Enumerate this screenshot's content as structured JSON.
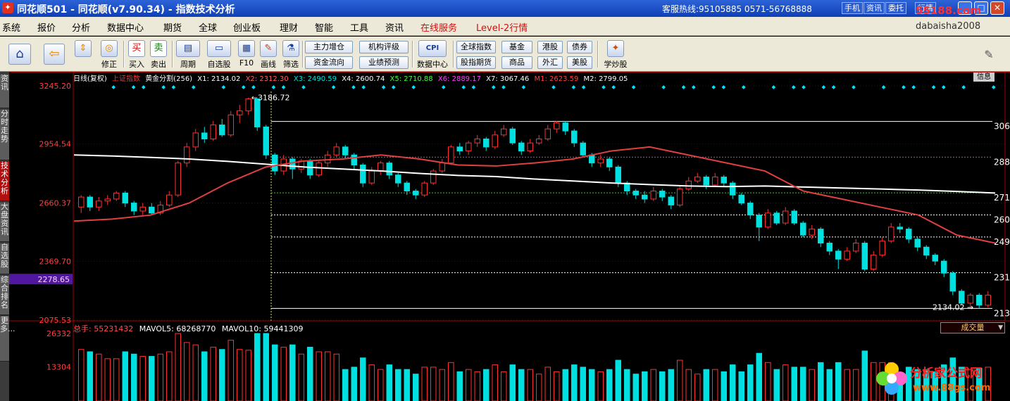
{
  "window": {
    "title": "同花顺501 - 同花顺(v7.90.34) - 指数技术分析",
    "hotline": "客服热线:95105885  0571-56768888",
    "buttons": [
      "手机",
      "资讯",
      "委托",
      "行情"
    ],
    "watermark_top": "55188.com"
  },
  "menu": {
    "items": [
      "系统",
      "报价",
      "分析",
      "数据中心",
      "期货",
      "全球",
      "创业板",
      "理财",
      "智能",
      "工具",
      "资讯"
    ],
    "highlight_items": [
      "在线服务",
      "Level-2行情"
    ],
    "user": "dabaisha2008"
  },
  "toolbar": {
    "big": [
      {
        "icon": "home-icon",
        "glyph": "⌂",
        "label": ""
      },
      {
        "icon": "back-arrow-icon",
        "glyph": "⇦",
        "label": ""
      },
      {
        "icon": "up-down-icon",
        "glyph": "⇕",
        "label": ""
      },
      {
        "icon": "refresh-icon",
        "glyph": "◎",
        "label": "修正"
      },
      {
        "icon": "buy-icon",
        "glyph": "买",
        "label": "买入"
      },
      {
        "icon": "sell-icon",
        "glyph": "卖",
        "label": "卖出"
      },
      {
        "icon": "period-icon",
        "glyph": "▤",
        "label": "周期"
      },
      {
        "icon": "watchlist-icon",
        "glyph": "▭",
        "label": "自选股"
      },
      {
        "icon": "f10-icon",
        "glyph": "▦",
        "label": "F10"
      },
      {
        "icon": "draw-line-icon",
        "glyph": "✎",
        "label": "画线"
      },
      {
        "icon": "filter-icon",
        "glyph": "⚗",
        "label": "筛选"
      }
    ],
    "small_grid": [
      [
        "主力增仓",
        "资金流向"
      ],
      [
        "机构评级",
        "业绩预测"
      ]
    ],
    "data_center": {
      "glyph": "CPI",
      "label": "数据中心"
    },
    "market_buttons": [
      [
        "全球指数",
        "股指期货"
      ],
      [
        "基金",
        "商品"
      ],
      [
        "港股",
        "外汇"
      ],
      [
        "债券",
        "美股"
      ]
    ],
    "learn": {
      "glyph": "✦",
      "label": "学炒股"
    },
    "settings_icon": "wrench-icon"
  },
  "left_tabs": [
    "资讯",
    "分时走势",
    "技术分析",
    "大盘资讯",
    "自选股",
    "综合排名",
    "更多..."
  ],
  "left_tabs_active": 2,
  "chart_info": {
    "period": "日线(复权)",
    "name": "上证指数",
    "golden": "黄金分割(256)",
    "levels": [
      {
        "label": "X1: 2134.02",
        "color": "#ffffff"
      },
      {
        "label": "X2: 2312.30",
        "color": "#ff6060"
      },
      {
        "label": "X3: 2490.59",
        "color": "#00e0e0"
      },
      {
        "label": "X4: 2600.74",
        "color": "#ffffff"
      },
      {
        "label": "X5: 2710.88",
        "color": "#40ff40"
      },
      {
        "label": "X6: 2889.17",
        "color": "#ff40ff"
      },
      {
        "label": "X7: 3067.46",
        "color": "#ffffff"
      },
      {
        "label": "M1: 2623.59",
        "color": "#ff4040"
      },
      {
        "label": "M2: 2799.05",
        "color": "#ffffff"
      }
    ],
    "info_button": "信息"
  },
  "chart_data": {
    "type": "candlestick",
    "y_ticks": [
      "3245.20",
      "2954.54",
      "2660.37",
      "2369.70",
      "2075.53"
    ],
    "y_tick_values": [
      3245.2,
      2954.54,
      2660.37,
      2369.7,
      2075.53
    ],
    "current_price": "2278.65",
    "ylim": [
      2075.53,
      3245.2
    ],
    "right_labels": [
      "306",
      "288",
      "271",
      "260",
      "249",
      "231",
      "213"
    ],
    "golden_levels": [
      3067.46,
      2889.17,
      2710.88,
      2600.74,
      2490.59,
      2312.3,
      2134.02
    ],
    "high_label": "3186.72",
    "low_label": "2134.02",
    "candles": [
      [
        2640,
        2690,
        2610,
        2700
      ],
      [
        2690,
        2640,
        2620,
        2700
      ],
      [
        2640,
        2670,
        2620,
        2690
      ],
      [
        2670,
        2680,
        2650,
        2700
      ],
      [
        2680,
        2710,
        2670,
        2720
      ],
      [
        2710,
        2660,
        2640,
        2720
      ],
      [
        2660,
        2620,
        2600,
        2670
      ],
      [
        2620,
        2640,
        2600,
        2660
      ],
      [
        2640,
        2610,
        2600,
        2660
      ],
      [
        2610,
        2650,
        2600,
        2670
      ],
      [
        2650,
        2700,
        2640,
        2720
      ],
      [
        2700,
        2860,
        2690,
        2870
      ],
      [
        2860,
        2940,
        2840,
        2960
      ],
      [
        2940,
        3010,
        2920,
        3030
      ],
      [
        3010,
        2980,
        2960,
        3040
      ],
      [
        2980,
        3050,
        2970,
        3070
      ],
      [
        3050,
        3000,
        2990,
        3080
      ],
      [
        3000,
        3100,
        2990,
        3120
      ],
      [
        3100,
        3120,
        3060,
        3150
      ],
      [
        3120,
        3180,
        3100,
        3186.72
      ],
      [
        3180,
        3040,
        3020,
        3180
      ],
      [
        3040,
        2900,
        2880,
        3050
      ],
      [
        2900,
        2820,
        2800,
        2910
      ],
      [
        2820,
        2880,
        2800,
        2900
      ],
      [
        2880,
        2830,
        2780,
        2890
      ],
      [
        2830,
        2870,
        2810,
        2880
      ],
      [
        2870,
        2800,
        2780,
        2880
      ],
      [
        2800,
        2860,
        2790,
        2870
      ],
      [
        2860,
        2900,
        2840,
        2920
      ],
      [
        2900,
        2940,
        2890,
        2960
      ],
      [
        2940,
        2900,
        2880,
        2950
      ],
      [
        2900,
        2850,
        2830,
        2910
      ],
      [
        2850,
        2760,
        2740,
        2860
      ],
      [
        2760,
        2820,
        2750,
        2840
      ],
      [
        2820,
        2860,
        2800,
        2870
      ],
      [
        2860,
        2800,
        2780,
        2870
      ],
      [
        2800,
        2760,
        2740,
        2810
      ],
      [
        2760,
        2720,
        2700,
        2770
      ],
      [
        2720,
        2700,
        2680,
        2730
      ],
      [
        2700,
        2760,
        2690,
        2770
      ],
      [
        2760,
        2820,
        2750,
        2830
      ],
      [
        2820,
        2860,
        2810,
        2880
      ],
      [
        2860,
        2940,
        2850,
        2950
      ],
      [
        2940,
        2920,
        2900,
        2960
      ],
      [
        2920,
        2960,
        2900,
        2970
      ],
      [
        2960,
        2980,
        2940,
        3000
      ],
      [
        2980,
        2940,
        2920,
        2990
      ],
      [
        2940,
        3000,
        2930,
        3020
      ],
      [
        3000,
        3030,
        2990,
        3050
      ],
      [
        3030,
        2960,
        2950,
        3040
      ],
      [
        2960,
        2920,
        2900,
        2970
      ],
      [
        2920,
        2960,
        2910,
        2980
      ],
      [
        2960,
        2980,
        2950,
        3000
      ],
      [
        2980,
        3030,
        2970,
        3050
      ],
      [
        3030,
        3060,
        3010,
        3070
      ],
      [
        3060,
        3020,
        3000,
        3070
      ],
      [
        3020,
        2960,
        2940,
        3030
      ],
      [
        2960,
        2900,
        2890,
        2970
      ],
      [
        2900,
        2860,
        2840,
        2910
      ],
      [
        2860,
        2880,
        2840,
        2900
      ],
      [
        2880,
        2840,
        2820,
        2890
      ],
      [
        2840,
        2760,
        2740,
        2850
      ],
      [
        2760,
        2720,
        2700,
        2770
      ],
      [
        2720,
        2700,
        2680,
        2730
      ],
      [
        2700,
        2680,
        2660,
        2720
      ],
      [
        2680,
        2720,
        2670,
        2740
      ],
      [
        2720,
        2690,
        2670,
        2730
      ],
      [
        2690,
        2650,
        2630,
        2700
      ],
      [
        2650,
        2730,
        2640,
        2750
      ],
      [
        2730,
        2770,
        2720,
        2790
      ],
      [
        2770,
        2790,
        2760,
        2810
      ],
      [
        2790,
        2750,
        2730,
        2800
      ],
      [
        2750,
        2790,
        2740,
        2810
      ],
      [
        2790,
        2760,
        2740,
        2800
      ],
      [
        2760,
        2700,
        2680,
        2770
      ],
      [
        2700,
        2660,
        2650,
        2710
      ],
      [
        2660,
        2600,
        2580,
        2670
      ],
      [
        2600,
        2540,
        2470,
        2610
      ],
      [
        2540,
        2610,
        2530,
        2630
      ],
      [
        2610,
        2560,
        2550,
        2620
      ],
      [
        2560,
        2620,
        2550,
        2640
      ],
      [
        2620,
        2560,
        2550,
        2630
      ],
      [
        2560,
        2500,
        2490,
        2570
      ],
      [
        2500,
        2530,
        2480,
        2550
      ],
      [
        2530,
        2460,
        2440,
        2540
      ],
      [
        2460,
        2420,
        2400,
        2470
      ],
      [
        2420,
        2380,
        2330,
        2430
      ],
      [
        2380,
        2420,
        2370,
        2440
      ],
      [
        2420,
        2460,
        2410,
        2480
      ],
      [
        2460,
        2330,
        2320,
        2470
      ],
      [
        2330,
        2400,
        2320,
        2420
      ],
      [
        2400,
        2470,
        2390,
        2490
      ],
      [
        2470,
        2540,
        2460,
        2560
      ],
      [
        2540,
        2530,
        2510,
        2560
      ],
      [
        2530,
        2480,
        2460,
        2540
      ],
      [
        2480,
        2440,
        2420,
        2490
      ],
      [
        2440,
        2400,
        2380,
        2450
      ],
      [
        2400,
        2370,
        2350,
        2410
      ],
      [
        2370,
        2310,
        2290,
        2380
      ],
      [
        2310,
        2220,
        2200,
        2320
      ],
      [
        2220,
        2160,
        2150,
        2230
      ],
      [
        2160,
        2200,
        2140,
        2210
      ],
      [
        2200,
        2150,
        2134.02,
        2210
      ],
      [
        2150,
        2200,
        2140,
        2220
      ]
    ],
    "ma_white": [
      2900,
      2895,
      2888,
      2880,
      2868,
      2854,
      2840,
      2830,
      2820,
      2808,
      2798,
      2792,
      2780,
      2770,
      2760,
      2752,
      2745,
      2742,
      2745,
      2740,
      2735,
      2730,
      2725,
      2718,
      2710
    ],
    "ma_red": [
      2570,
      2580,
      2600,
      2660,
      2760,
      2840,
      2870,
      2880,
      2900,
      2880,
      2850,
      2845,
      2860,
      2880,
      2920,
      2940,
      2900,
      2860,
      2820,
      2720,
      2680,
      2640,
      2600,
      2500,
      2460
    ],
    "vol_info": {
      "total": "总手: 55231432",
      "ma5": "MAVOL5: 68268770",
      "ma10": "MAVOL10: 59441309"
    },
    "vol_ticks": [
      "26332",
      "13304"
    ],
    "vol_tick_values": [
      26332,
      13304
    ],
    "vol_selector": "成交量"
  },
  "watermark_bottom": {
    "title": "分析家公式网",
    "url": "www.88gs.com"
  }
}
